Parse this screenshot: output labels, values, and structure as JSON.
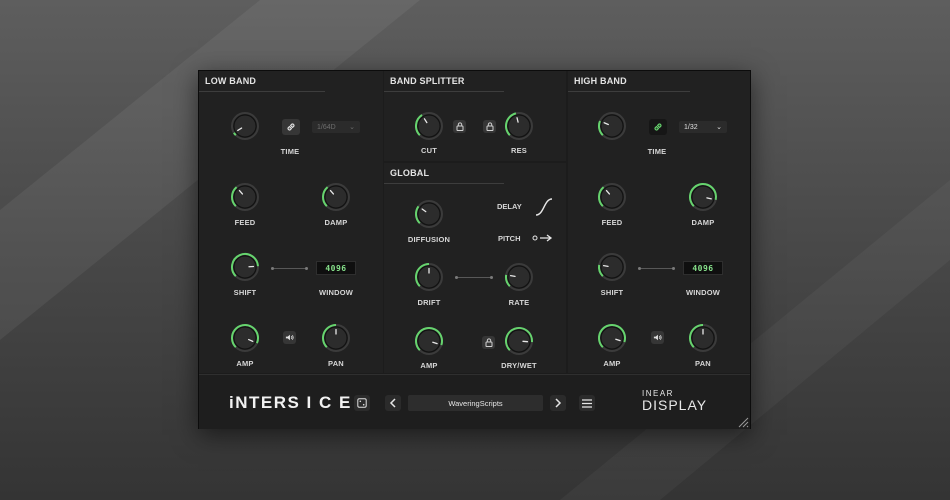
{
  "theme": {
    "accent": "#66d46e",
    "panel": "#212121",
    "display_text": "#86e08a"
  },
  "low_band": {
    "title": "LOW BAND",
    "link_icon": "link-icon",
    "time_select": "1/64D",
    "knobs": {
      "time": "TIME",
      "feed": "FEED",
      "damp": "DAMP",
      "shift": "SHIFT",
      "window": "WINDOW",
      "amp": "AMP",
      "pan": "PAN"
    },
    "window_value": "4096",
    "speaker_icon": "speaker-icon"
  },
  "band_splitter": {
    "title": "BAND SPLITTER",
    "cut": "CUT",
    "res": "RES",
    "lock_icon": "lock-icon"
  },
  "global": {
    "title": "GLOBAL",
    "delay": "DELAY",
    "pitch": "PITCH",
    "diffusion": "DIFFUSION",
    "drift": "DRIFT",
    "rate": "RATE",
    "amp": "AMP",
    "dry_wet": "DRY/WET"
  },
  "high_band": {
    "title": "HIGH BAND",
    "time_select": "1/32",
    "knobs": {
      "time": "TIME",
      "feed": "FEED",
      "damp": "DAMP",
      "shift": "SHIFT",
      "window": "WINDOW",
      "amp": "AMP",
      "pan": "PAN"
    },
    "window_value": "4096"
  },
  "footer": {
    "product": "iNTERS I C E",
    "preset_name": "WaveringScripts",
    "brand_line1": "INEAR",
    "brand_line2": "DISPLAY"
  },
  "knob_values": {
    "low_time": 0.05,
    "low_feed": 0.35,
    "low_damp": 0.35,
    "low_shift": 0.82,
    "low_amp": 0.92,
    "low_pan": 0.5,
    "cut": 0.38,
    "res": 0.45,
    "diffusion": 0.3,
    "drift": 0.5,
    "rate": 0.2,
    "g_amp": 0.9,
    "drywet": 0.85,
    "high_time": 0.25,
    "high_feed": 0.35,
    "high_damp": 0.88,
    "high_shift": 0.2,
    "high_amp": 0.9,
    "high_pan": 0.5
  }
}
